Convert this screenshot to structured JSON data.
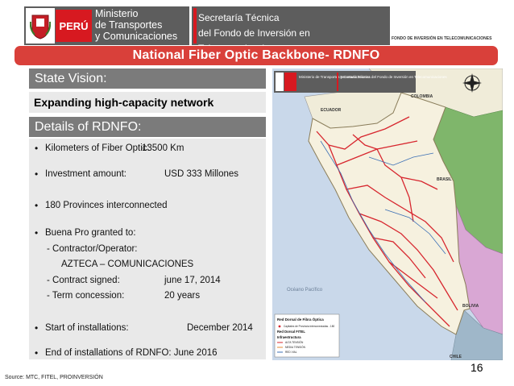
{
  "header": {
    "ministry": "Ministerio\nde Transportes\ny Comunicaciones",
    "peru_label": "PERÚ",
    "secretaria": "Secretaría Técnica\ndel Fondo de Inversión en Telecomunicaciones",
    "fondo_tag": "FONDO DE INVERSIÓN EN TELECOMUNICACIONES"
  },
  "banner": {
    "title": "National Fiber Optic Backbone- RDNFO"
  },
  "state_vision": {
    "heading": "State Vision:",
    "text": "Expanding high-capacity network"
  },
  "details": {
    "heading": "Details of RDNFO:",
    "km_label": "Kilometers of Fiber Optic:",
    "km_value": "13500 Km",
    "inv_label": "Investment amount:",
    "inv_value": "USD 333 Millones",
    "provinces": "180 Provinces interconnected",
    "buena_pro": "Buena Pro granted to:",
    "contractor_label": "- Contractor/Operator:",
    "contractor_value": "AZTECA – COMUNICACIONES",
    "signed_label": "- Contract signed:",
    "signed_value": "june 17, 2014",
    "term_label": "- Term concession:",
    "term_value": "20 years",
    "start_label": "Start of installations:",
    "start_value": "December 2014",
    "end_text": "End of installations of RDNFO: June 2016"
  },
  "map": {
    "header_left": "Ministerio de Transportes y Comunicaciones",
    "header_right": "Secretaría Técnica del Fondo de Inversión en Telecomunicaciones",
    "label_colombia": "COLOMBIA",
    "label_ecuador": "ECUADOR",
    "label_brasil": "BRASIL",
    "label_bolivia": "BOLIVIA",
    "label_chile": "CHILE",
    "label_ocean": "Océano Pacífico",
    "legend_title": "Red Dorsal de Fibra Óptica",
    "legend_l1": "Capitales de Provincia interconectadas - 180",
    "legend_l2": "Red Dorsal FITEL",
    "legend_l3": "Infraestructura",
    "legend_l4": "ALTA TENSIÓN",
    "legend_l5": "MEDIA TENSIÓN",
    "legend_l6": "RED VIAL"
  },
  "page_number": "16",
  "source": "Source: MTC, FITEL, PROINVERSIÓN",
  "colors": {
    "banner": "#d9403a",
    "header": "#5d5d5d",
    "peru_red": "#d71920",
    "panel_head": "#7b7b7b",
    "panel_body": "#e9e9e9"
  }
}
